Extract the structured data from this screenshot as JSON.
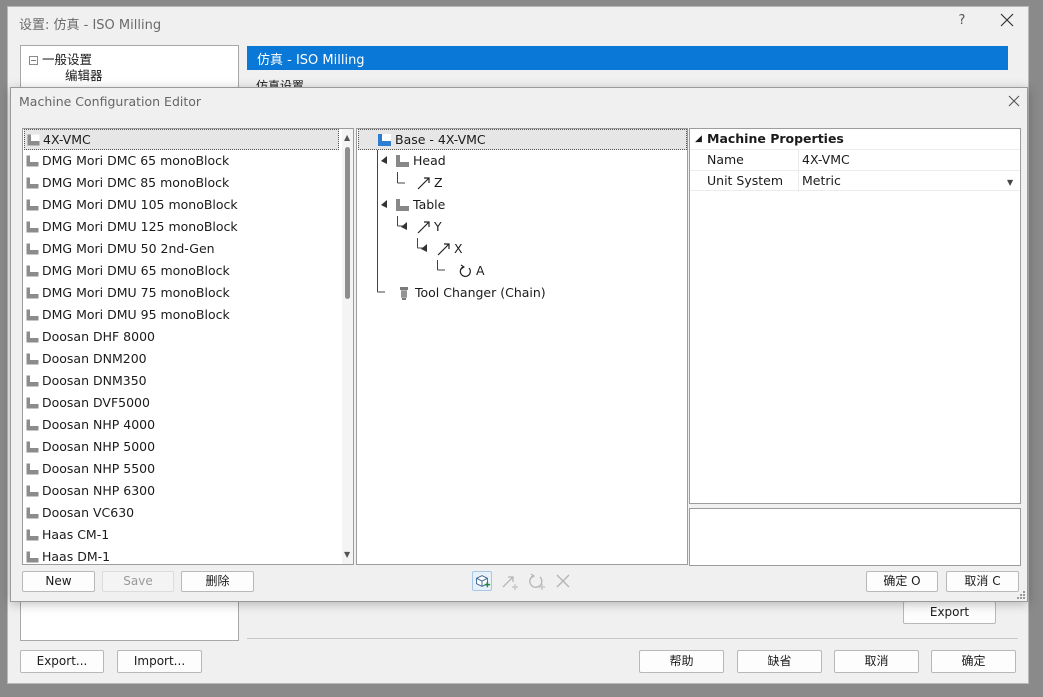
{
  "background_window": {
    "title": "设置: 仿真 - ISO Milling",
    "help_label": "?",
    "tree": {
      "root_label": "一般设置",
      "child_label": "编辑器"
    },
    "header_title": "仿真 - ISO Milling",
    "subheader": "仿真设置",
    "export_label": "Export",
    "export_dots_label": "Export...",
    "import_dots_label": "Import...",
    "help_button": "帮助",
    "default_button": "缺省",
    "cancel_button": "取消",
    "ok_button": "确定"
  },
  "dialog": {
    "title": "Machine Configuration Editor",
    "machines": [
      "4X-VMC",
      "DMG Mori DMC 65 monoBlock",
      "DMG Mori DMC 85 monoBlock",
      "DMG Mori DMU 105 monoBlock",
      "DMG Mori DMU 125 monoBlock",
      "DMG Mori DMU 50 2nd-Gen",
      "DMG Mori DMU 65 monoBlock",
      "DMG Mori DMU 75 monoBlock",
      "DMG Mori DMU 95 monoBlock",
      "Doosan DHF 8000",
      "Doosan DNM200",
      "Doosan DNM350",
      "Doosan DVF5000",
      "Doosan NHP 4000",
      "Doosan NHP 5000",
      "Doosan NHP 5500",
      "Doosan NHP 6300",
      "Doosan VC630",
      "Haas CM-1",
      "Haas DM-1"
    ],
    "selected_machine_index": 0,
    "tree": {
      "base": "Base - 4X-VMC",
      "head": "Head",
      "z": "Z",
      "table": "Table",
      "y": "Y",
      "x": "X",
      "a": "A",
      "tool_changer": "Tool Changer (Chain)"
    },
    "properties": {
      "section_title": "Machine Properties",
      "rows": [
        {
          "name": "Name",
          "value": "4X-VMC"
        },
        {
          "name": "Unit System",
          "value": "Metric"
        }
      ]
    },
    "buttons": {
      "new": "New",
      "save": "Save",
      "delete": "删除",
      "ok": "确定 O",
      "cancel": "取消 C"
    },
    "icons": {
      "add_component": "add-component-icon",
      "add_axis": "add-axis-icon",
      "add_rotary": "add-rotary-icon",
      "remove": "remove-icon"
    },
    "colors": {
      "accent": "#0a78d7",
      "selection": "#e6e6e6"
    }
  }
}
